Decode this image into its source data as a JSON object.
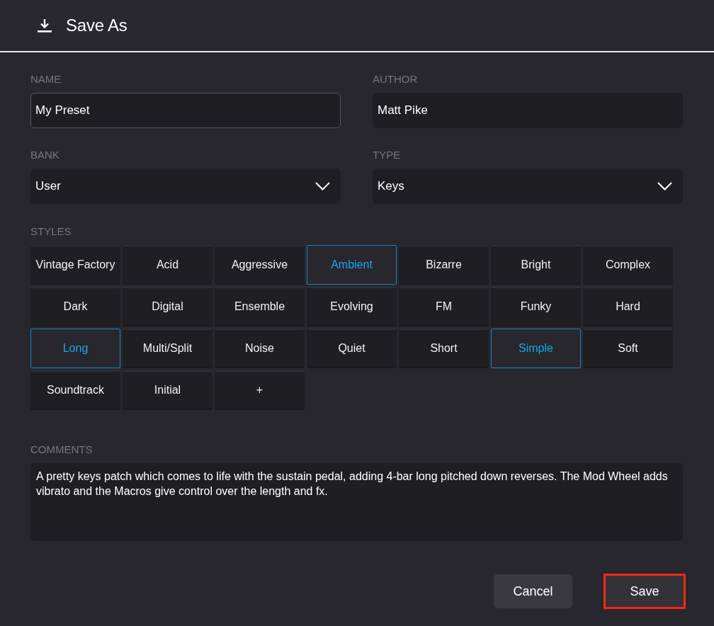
{
  "window": {
    "title": "Save As"
  },
  "fields": [
    {
      "kind": "text",
      "label": "NAME",
      "value": "My Preset",
      "focused": true
    },
    {
      "kind": "text",
      "label": "AUTHOR",
      "value": "Matt Pike",
      "focused": false
    },
    {
      "kind": "select",
      "label": "BANK",
      "value": "User",
      "focused": false
    },
    {
      "kind": "select",
      "label": "TYPE",
      "value": "Keys",
      "focused": false
    }
  ],
  "styles": {
    "label": "STYLES",
    "tags": [
      {
        "label": "Vintage Factory",
        "selected": false
      },
      {
        "label": "Acid",
        "selected": false
      },
      {
        "label": "Aggressive",
        "selected": false
      },
      {
        "label": "Ambient",
        "selected": true
      },
      {
        "label": "Bizarre",
        "selected": false
      },
      {
        "label": "Bright",
        "selected": false
      },
      {
        "label": "Complex",
        "selected": false
      },
      {
        "label": "Dark",
        "selected": false
      },
      {
        "label": "Digital",
        "selected": false
      },
      {
        "label": "Ensemble",
        "selected": false
      },
      {
        "label": "Evolving",
        "selected": false
      },
      {
        "label": "FM",
        "selected": false
      },
      {
        "label": "Funky",
        "selected": false
      },
      {
        "label": "Hard",
        "selected": false
      },
      {
        "label": "Long",
        "selected": true
      },
      {
        "label": "Multi/Split",
        "selected": false
      },
      {
        "label": "Noise",
        "selected": false
      },
      {
        "label": "Quiet",
        "selected": false
      },
      {
        "label": "Short",
        "selected": false
      },
      {
        "label": "Simple",
        "selected": true
      },
      {
        "label": "Soft",
        "selected": false
      },
      {
        "label": "Soundtrack",
        "selected": false
      },
      {
        "label": "Initial",
        "selected": false
      }
    ],
    "add_button": {
      "label": "+"
    }
  },
  "comments": {
    "label": "COMMENTS",
    "value": "A pretty keys patch which comes to life with the sustain pedal, adding 4-bar long pitched down reverses. The Mod Wheel adds vibrato and the Macros give control over the length and fx."
  },
  "buttons": [
    {
      "label": "Cancel",
      "highlighted": false
    },
    {
      "label": "Save",
      "highlighted": true
    }
  ]
}
